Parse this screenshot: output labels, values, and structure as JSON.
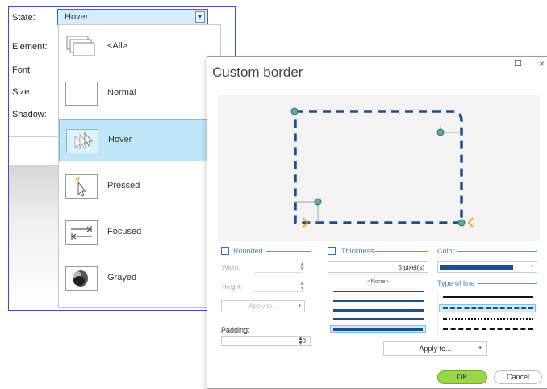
{
  "properties": {
    "state_label": "State:",
    "state_value": "Hover",
    "element_label": "Element:",
    "font_label": "Font:",
    "size_label": "Size:",
    "shadow_label": "Shadow:"
  },
  "state_dropdown": {
    "items": [
      {
        "label": "<All>",
        "icon": "all-states-icon"
      },
      {
        "label": "Normal",
        "icon": "normal-state-icon"
      },
      {
        "label": "Hover",
        "icon": "hover-state-icon",
        "selected": true
      },
      {
        "label": "Pressed",
        "icon": "pressed-state-icon"
      },
      {
        "label": "Focused",
        "icon": "focused-state-icon"
      },
      {
        "label": "Grayed",
        "icon": "grayed-state-icon"
      }
    ]
  },
  "dialog": {
    "title": "Custom border",
    "maximize_glyph": "☐",
    "close_glyph": "×",
    "rounded_label": "Rounded",
    "width_label": "Width:",
    "height_label": "Height:",
    "apply_to_small": "Apply to...",
    "padding_label": "Padding:",
    "padding_value": "0",
    "thickness_label": "Thickness",
    "thickness_value": "5 pixel(s)",
    "thickness_none": "<None>",
    "color_label": "Color",
    "color_value": "#1c4f8f",
    "type_of_line_label": "Type of line",
    "apply_to_label": "Apply to...",
    "ok_label": "OK",
    "cancel_label": "Cancel"
  }
}
